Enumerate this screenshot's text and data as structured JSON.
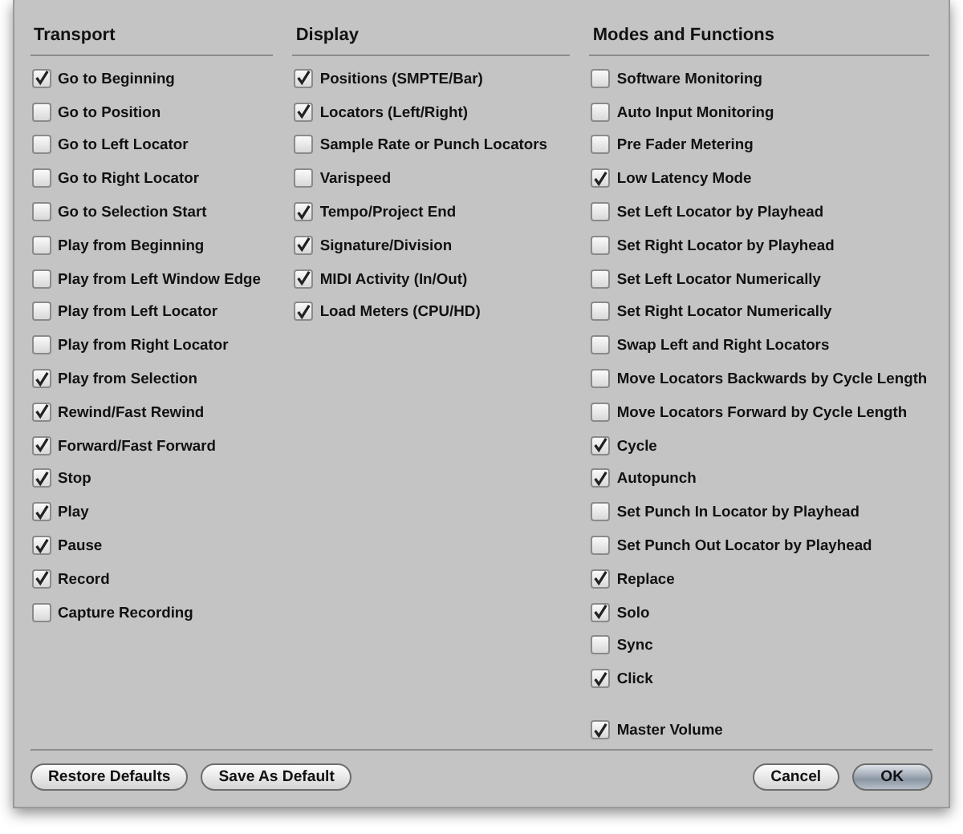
{
  "columns": [
    {
      "title": "Transport",
      "groups": [
        [
          {
            "label": "Go to Beginning",
            "checked": true
          },
          {
            "label": "Go to Position",
            "checked": false
          },
          {
            "label": "Go to Left Locator",
            "checked": false
          },
          {
            "label": "Go to Right Locator",
            "checked": false
          },
          {
            "label": "Go to Selection Start",
            "checked": false
          },
          {
            "label": "Play from Beginning",
            "checked": false
          },
          {
            "label": "Play from Left Window Edge",
            "checked": false
          },
          {
            "label": "Play from Left Locator",
            "checked": false
          },
          {
            "label": "Play from Right Locator",
            "checked": false
          },
          {
            "label": "Play from Selection",
            "checked": true
          },
          {
            "label": "Rewind/Fast Rewind",
            "checked": true
          },
          {
            "label": "Forward/Fast Forward",
            "checked": true
          },
          {
            "label": "Stop",
            "checked": true
          },
          {
            "label": "Play",
            "checked": true
          },
          {
            "label": "Pause",
            "checked": true
          },
          {
            "label": "Record",
            "checked": true
          },
          {
            "label": "Capture Recording",
            "checked": false
          }
        ]
      ]
    },
    {
      "title": "Display",
      "groups": [
        [
          {
            "label": "Positions (SMPTE/Bar)",
            "checked": true
          },
          {
            "label": "Locators (Left/Right)",
            "checked": true
          },
          {
            "label": "Sample Rate or Punch Locators",
            "checked": false
          },
          {
            "label": "Varispeed",
            "checked": false
          },
          {
            "label": "Tempo/Project End",
            "checked": true
          },
          {
            "label": "Signature/Division",
            "checked": true
          },
          {
            "label": "MIDI Activity (In/Out)",
            "checked": true
          },
          {
            "label": "Load Meters (CPU/HD)",
            "checked": true
          }
        ]
      ]
    },
    {
      "title": "Modes and Functions",
      "groups": [
        [
          {
            "label": "Software Monitoring",
            "checked": false
          },
          {
            "label": "Auto Input Monitoring",
            "checked": false
          },
          {
            "label": "Pre Fader Metering",
            "checked": false
          },
          {
            "label": "Low Latency Mode",
            "checked": true
          },
          {
            "label": "Set Left Locator by Playhead",
            "checked": false
          },
          {
            "label": "Set Right Locator by Playhead",
            "checked": false
          },
          {
            "label": "Set Left Locator Numerically",
            "checked": false
          },
          {
            "label": "Set Right Locator Numerically",
            "checked": false
          },
          {
            "label": "Swap Left and Right Locators",
            "checked": false
          },
          {
            "label": "Move Locators Backwards by Cycle Length",
            "checked": false
          },
          {
            "label": "Move Locators Forward by Cycle Length",
            "checked": false
          },
          {
            "label": "Cycle",
            "checked": true
          },
          {
            "label": "Autopunch",
            "checked": true
          },
          {
            "label": "Set Punch In Locator by Playhead",
            "checked": false
          },
          {
            "label": "Set Punch Out Locator by Playhead",
            "checked": false
          },
          {
            "label": "Replace",
            "checked": true
          },
          {
            "label": "Solo",
            "checked": true
          },
          {
            "label": "Sync",
            "checked": false
          },
          {
            "label": "Click",
            "checked": true
          }
        ],
        [
          {
            "label": "Master Volume",
            "checked": true
          }
        ]
      ]
    }
  ],
  "left_buttons": [
    {
      "label": "Restore Defaults",
      "default": false
    },
    {
      "label": "Save As Default",
      "default": false
    }
  ],
  "right_buttons": [
    {
      "label": "Cancel",
      "default": false
    },
    {
      "label": "OK",
      "default": true
    }
  ]
}
